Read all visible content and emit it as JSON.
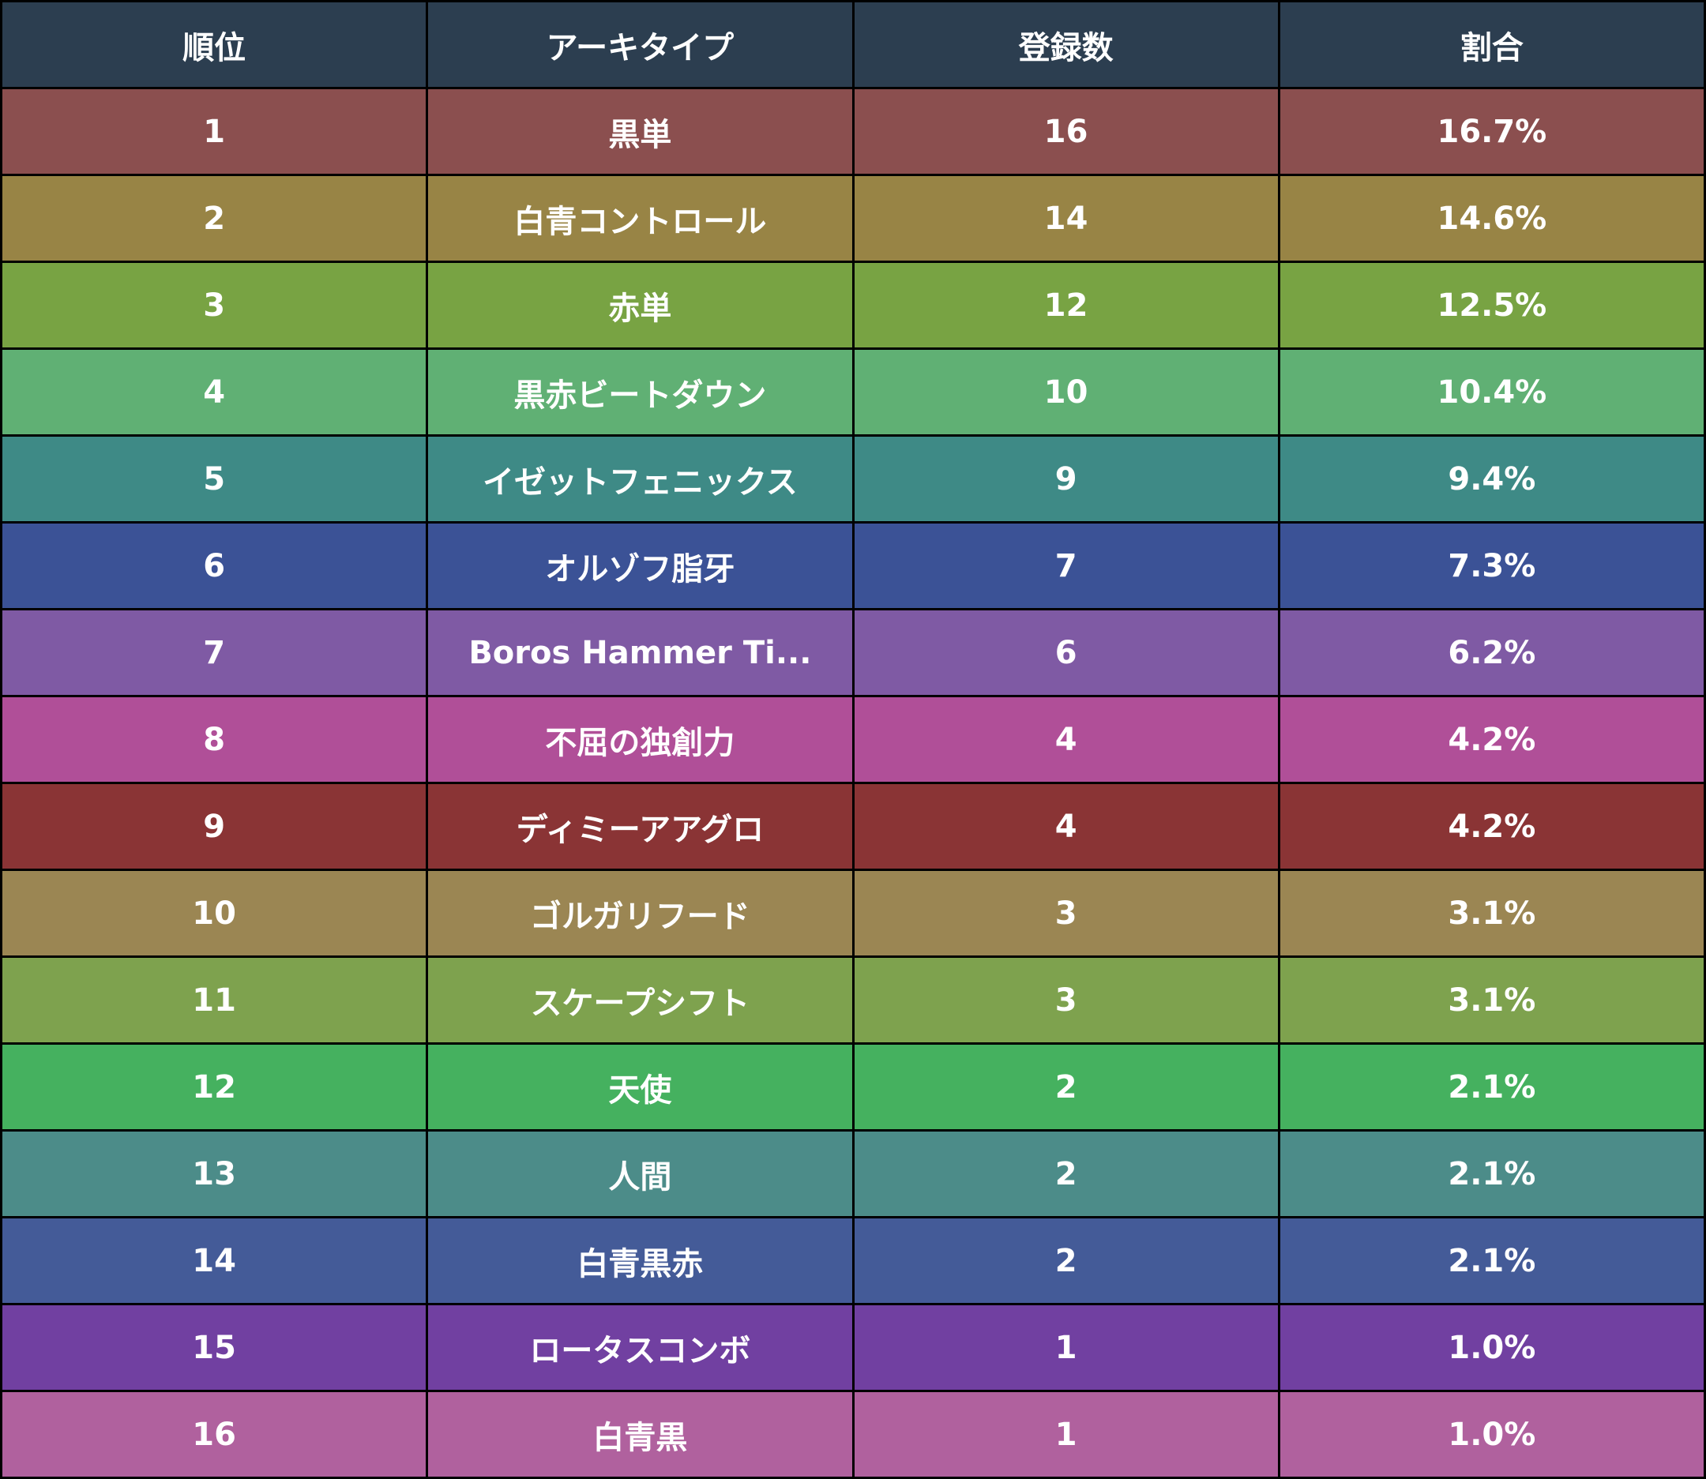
{
  "chart_data": {
    "type": "table",
    "columns": [
      "順位",
      "アーキタイプ",
      "登録数",
      "割合"
    ],
    "header_color": "#2c3e50",
    "rows": [
      {
        "cells": [
          "1",
          "黒単",
          "16",
          "16.7%"
        ],
        "color": "#8b4f4f"
      },
      {
        "cells": [
          "2",
          "白青コントロール",
          "14",
          "14.6%"
        ],
        "color": "#988445"
      },
      {
        "cells": [
          "3",
          "赤単",
          "12",
          "12.5%"
        ],
        "color": "#78a343"
      },
      {
        "cells": [
          "4",
          "黒赤ビートダウン",
          "10",
          "10.4%"
        ],
        "color": "#60b074"
      },
      {
        "cells": [
          "5",
          "イゼットフェニックス",
          "9",
          "9.4%"
        ],
        "color": "#3e8a86"
      },
      {
        "cells": [
          "6",
          "オルゾフ脂牙",
          "7",
          "7.3%"
        ],
        "color": "#3b5296"
      },
      {
        "cells": [
          "7",
          "Boros Hammer Ti...",
          "6",
          "6.2%"
        ],
        "color": "#7f5aa4"
      },
      {
        "cells": [
          "8",
          "不屈の独創力",
          "4",
          "4.2%"
        ],
        "color": "#b04f98"
      },
      {
        "cells": [
          "9",
          "ディミーアアグロ",
          "4",
          "4.2%"
        ],
        "color": "#8a3435"
      },
      {
        "cells": [
          "10",
          "ゴルガリフード",
          "3",
          "3.1%"
        ],
        "color": "#9b8653"
      },
      {
        "cells": [
          "11",
          "スケープシフト",
          "3",
          "3.1%"
        ],
        "color": "#7ea24e"
      },
      {
        "cells": [
          "12",
          "天使",
          "2",
          "2.1%"
        ],
        "color": "#45b15f"
      },
      {
        "cells": [
          "13",
          "人間",
          "2",
          "2.1%"
        ],
        "color": "#4c8c89"
      },
      {
        "cells": [
          "14",
          "白青黒赤",
          "2",
          "2.1%"
        ],
        "color": "#445b98"
      },
      {
        "cells": [
          "15",
          "ロータスコンボ",
          "1",
          "1.0%"
        ],
        "color": "#7140a1"
      },
      {
        "cells": [
          "16",
          "白青黒",
          "1",
          "1.0%"
        ],
        "color": "#b0619e"
      }
    ]
  }
}
